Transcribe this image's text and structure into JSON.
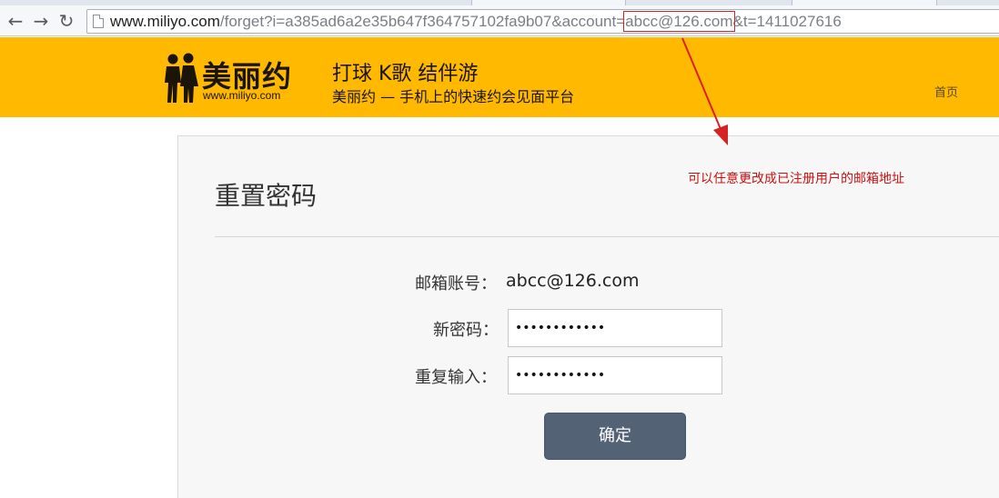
{
  "browser": {
    "url": {
      "host": "www.miliyo.com",
      "path_before": "/forget?i=a385ad6a2e35b647f364757102fa9b07&account=",
      "highlighted": "abcc@126.com",
      "path_after": "&t=1411027616"
    },
    "back_icon": "←",
    "forward_icon": "→",
    "reload_icon": "↻"
  },
  "header": {
    "logo_name": "美丽约",
    "logo_url": "www.miliyo.com",
    "slogan_main": "打球 K歌 结伴游",
    "slogan_sub": "美丽约 — 手机上的快速约会见面平台",
    "nav_home": "首页"
  },
  "annotation": {
    "text": "可以任意更改成已注册用户的邮箱地址",
    "color": "#cc1111"
  },
  "form": {
    "title": "重置密码",
    "account_label": "邮箱账号：",
    "account_value": "abcc@126.com",
    "new_password_label": "新密码：",
    "new_password_value": "••••••••••••",
    "confirm_password_label": "重复输入：",
    "confirm_password_value": "••••••••••••",
    "submit_label": "确定"
  },
  "colors": {
    "header_bg": "#ffb900",
    "button_bg": "#546276",
    "highlight_box": "#d62222"
  }
}
